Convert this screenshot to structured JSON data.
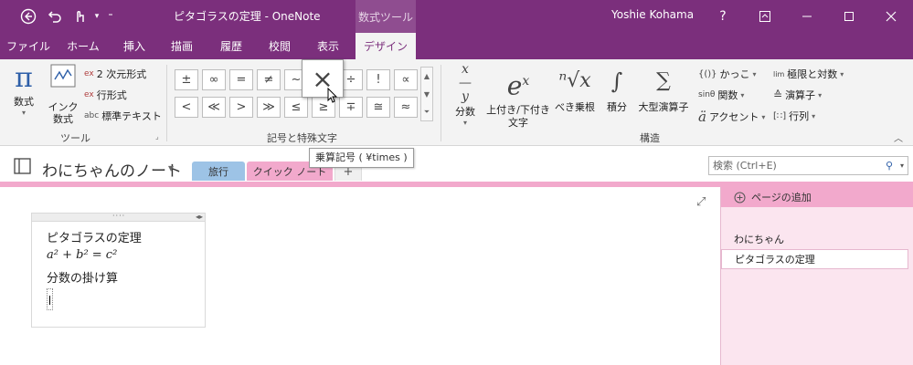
{
  "titlebar": {
    "title": "ピタゴラスの定理 - OneNote",
    "context_tab": "数式ツール",
    "user": "Yoshie Kohama",
    "help": "?",
    "back_icon": "back-arrow-icon",
    "undo_icon": "undo-icon",
    "touch_icon": "touch-mode-icon",
    "customize_icon": "customize-quick-access-icon",
    "ribbon_display_icon": "ribbon-display-options-icon",
    "minimize_icon": "minimize-icon",
    "maximize_icon": "maximize-icon",
    "close_icon": "close-icon"
  },
  "menu": {
    "tabs": [
      "ファイル",
      "ホーム",
      "挿入",
      "描画",
      "履歴",
      "校閲",
      "表示",
      "デザイン"
    ],
    "active": "デザイン"
  },
  "ribbon": {
    "tools": {
      "equation_label": "数式",
      "ink_equation_line1": "インク",
      "ink_equation_line2": "数式",
      "professional": "2 次元形式",
      "linear": "行形式",
      "normal_text": "標準テキスト",
      "group_label": "ツール"
    },
    "symbols": {
      "items": [
        "±",
        "∞",
        "=",
        "≠",
        "~",
        "×",
        "÷",
        "!",
        "∝",
        "<",
        "≪",
        ">",
        "≫",
        "≤",
        "≥",
        "∓",
        "≅",
        "≈"
      ],
      "hover_symbol": "×",
      "group_label": "記号と特殊文字"
    },
    "structures": {
      "fraction": "分数",
      "script_line1": "上付き/下付き",
      "script_line2": "文字",
      "radical": "べき乗根",
      "integral": "積分",
      "large_operator": "大型演算子",
      "bracket": "かっこ",
      "function": "関数",
      "accent": "アクセント",
      "limit_log": "極限と対数",
      "operator": "演算子",
      "matrix": "行列",
      "group_label": "構造"
    }
  },
  "tooltip": "乗算記号 ( ¥times )",
  "notebook": {
    "name": "わにちゃんのノート",
    "sections": [
      "旅行",
      "クイック ノート",
      "+"
    ],
    "active_section": "クイック ノート"
  },
  "search": {
    "placeholder": "検索 (Ctrl+E)"
  },
  "note": {
    "title_line": "ピタゴラスの定理",
    "equation": "a² + b² = c²",
    "line3": "分数の掛け算"
  },
  "pages": {
    "add_page": "ページの追加",
    "items": [
      "わにちゃん",
      "ピタゴラスの定理"
    ],
    "selected": "ピタゴラスの定理"
  },
  "colors": {
    "accent": "#7b2f7c",
    "section_quick_notes": "#f2a9cc",
    "section_travel": "#9dc3e6"
  }
}
